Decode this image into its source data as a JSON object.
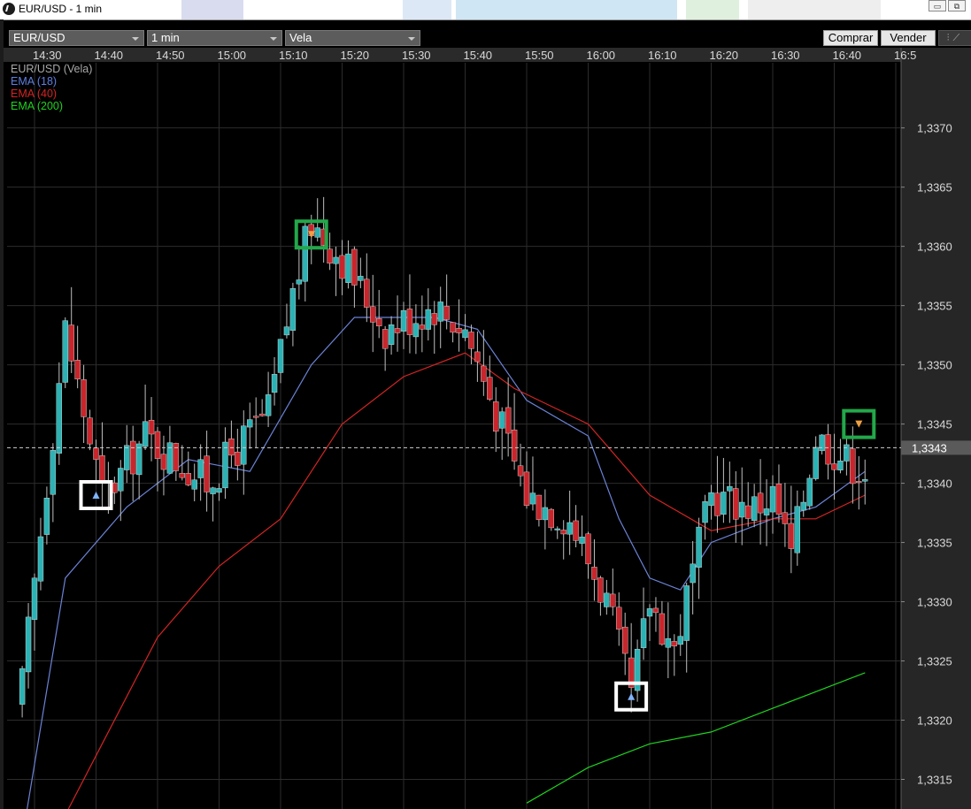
{
  "window": {
    "title": "EUR/USD - 1 min"
  },
  "toolbar": {
    "symbol": "EUR/USD",
    "timeframe": "1 min",
    "chart_style": "Vela",
    "buy_label": "Comprar",
    "sell_label": "Vender"
  },
  "legend": {
    "instrument": "EUR/USD (Vela)",
    "ema18": "EMA (18)",
    "ema40": "EMA (40)",
    "ema200": "EMA (200)"
  },
  "colors": {
    "background": "#000000",
    "bull_candle": "#2bb2b4",
    "bear_candle": "#c8262c",
    "ema18": "#6b83d6",
    "ema40": "#d42424",
    "ema200": "#1fd21f",
    "grid": "#2c2c2c",
    "signal_buy_box": "#ffffff",
    "signal_sell_box": "#22a84a",
    "price_axis_bg": "#262626"
  },
  "chart_data": {
    "type": "candlestick",
    "title": "EUR/USD - 1 min",
    "x_tick_labels": [
      "14:30",
      "14:40",
      "14:50",
      "15:00",
      "15:10",
      "15:20",
      "15:30",
      "15:40",
      "15:50",
      "16:00",
      "16:10",
      "16:20",
      "16:30",
      "16:40",
      "16:5"
    ],
    "y_tick_labels": [
      "1,3370",
      "1,3365",
      "1,3360",
      "1,3355",
      "1,3350",
      "1,3345",
      "1,3340",
      "1,3335",
      "1,3330",
      "1,3325",
      "1,3320",
      "1,3315"
    ],
    "y_ticks": [
      1.337,
      1.3365,
      1.336,
      1.3355,
      1.335,
      1.3345,
      1.334,
      1.3335,
      1.333,
      1.3325,
      1.332,
      1.3315
    ],
    "ylim": [
      1.33125,
      1.33755
    ],
    "grid": true,
    "current_price": 1.3343,
    "current_price_label": "1,3343",
    "candle_summary": [
      {
        "time": "14:28",
        "close": 1.3323
      },
      {
        "time": "14:35",
        "close": 1.3353
      },
      {
        "time": "14:38",
        "close": 1.3346
      },
      {
        "time": "14:41",
        "close": 1.3339
      },
      {
        "time": "14:43",
        "close": 1.334
      },
      {
        "time": "14:48",
        "close": 1.3344
      },
      {
        "time": "14:58",
        "close": 1.334
      },
      {
        "time": "15:08",
        "close": 1.3346
      },
      {
        "time": "15:12",
        "close": 1.3356
      },
      {
        "time": "15:15",
        "close": 1.3362
      },
      {
        "time": "15:20",
        "close": 1.3359
      },
      {
        "time": "15:27",
        "close": 1.3353
      },
      {
        "time": "15:35",
        "close": 1.3355
      },
      {
        "time": "15:40",
        "close": 1.3353
      },
      {
        "time": "15:45",
        "close": 1.3346
      },
      {
        "time": "15:50",
        "close": 1.3339
      },
      {
        "time": "15:57",
        "close": 1.3337
      },
      {
        "time": "16:03",
        "close": 1.333
      },
      {
        "time": "16:07",
        "close": 1.3322
      },
      {
        "time": "16:10",
        "close": 1.333
      },
      {
        "time": "16:14",
        "close": 1.3326
      },
      {
        "time": "16:20",
        "close": 1.3339
      },
      {
        "time": "16:27",
        "close": 1.3338
      },
      {
        "time": "16:30",
        "close": 1.3339
      },
      {
        "time": "16:33",
        "close": 1.3334
      },
      {
        "time": "16:37",
        "close": 1.3344
      },
      {
        "time": "16:42",
        "close": 1.3342
      },
      {
        "time": "16:45",
        "close": 1.3341
      }
    ],
    "series": [
      {
        "name": "EMA (18)",
        "values": [
          [
            "14:28",
            1.331
          ],
          [
            "14:35",
            1.3332
          ],
          [
            "14:45",
            1.3338
          ],
          [
            "14:55",
            1.3342
          ],
          [
            "15:05",
            1.3341
          ],
          [
            "15:15",
            1.335
          ],
          [
            "15:22",
            1.3354
          ],
          [
            "15:35",
            1.3354
          ],
          [
            "15:42",
            1.3353
          ],
          [
            "15:50",
            1.3347
          ],
          [
            "16:00",
            1.3344
          ],
          [
            "16:05",
            1.3337
          ],
          [
            "16:10",
            1.3332
          ],
          [
            "16:15",
            1.3331
          ],
          [
            "16:20",
            1.3335
          ],
          [
            "16:30",
            1.3337
          ],
          [
            "16:37",
            1.3338
          ],
          [
            "16:45",
            1.3341
          ]
        ]
      },
      {
        "name": "EMA (40)",
        "values": [
          [
            "14:33",
            1.331
          ],
          [
            "14:40",
            1.3317
          ],
          [
            "14:50",
            1.3327
          ],
          [
            "15:00",
            1.3333
          ],
          [
            "15:10",
            1.3337
          ],
          [
            "15:20",
            1.3345
          ],
          [
            "15:30",
            1.3349
          ],
          [
            "15:40",
            1.3351
          ],
          [
            "15:48",
            1.3348
          ],
          [
            "16:00",
            1.3345
          ],
          [
            "16:10",
            1.3339
          ],
          [
            "16:20",
            1.3336
          ],
          [
            "16:30",
            1.3337
          ],
          [
            "16:37",
            1.3337
          ],
          [
            "16:45",
            1.3339
          ]
        ]
      },
      {
        "name": "EMA (200)",
        "values": [
          [
            "15:50",
            1.3313
          ],
          [
            "16:00",
            1.3316
          ],
          [
            "16:10",
            1.3318
          ],
          [
            "16:20",
            1.3319
          ],
          [
            "16:30",
            1.3321
          ],
          [
            "16:40",
            1.3323
          ],
          [
            "16:45",
            1.3324
          ]
        ]
      }
    ],
    "signals": [
      {
        "time": "14:40",
        "price": 1.3339,
        "type": "buy"
      },
      {
        "time": "15:15",
        "price": 1.3361,
        "type": "sell"
      },
      {
        "time": "16:07",
        "price": 1.3322,
        "type": "buy"
      },
      {
        "time": "16:44",
        "price": 1.3345,
        "type": "sell"
      }
    ]
  }
}
